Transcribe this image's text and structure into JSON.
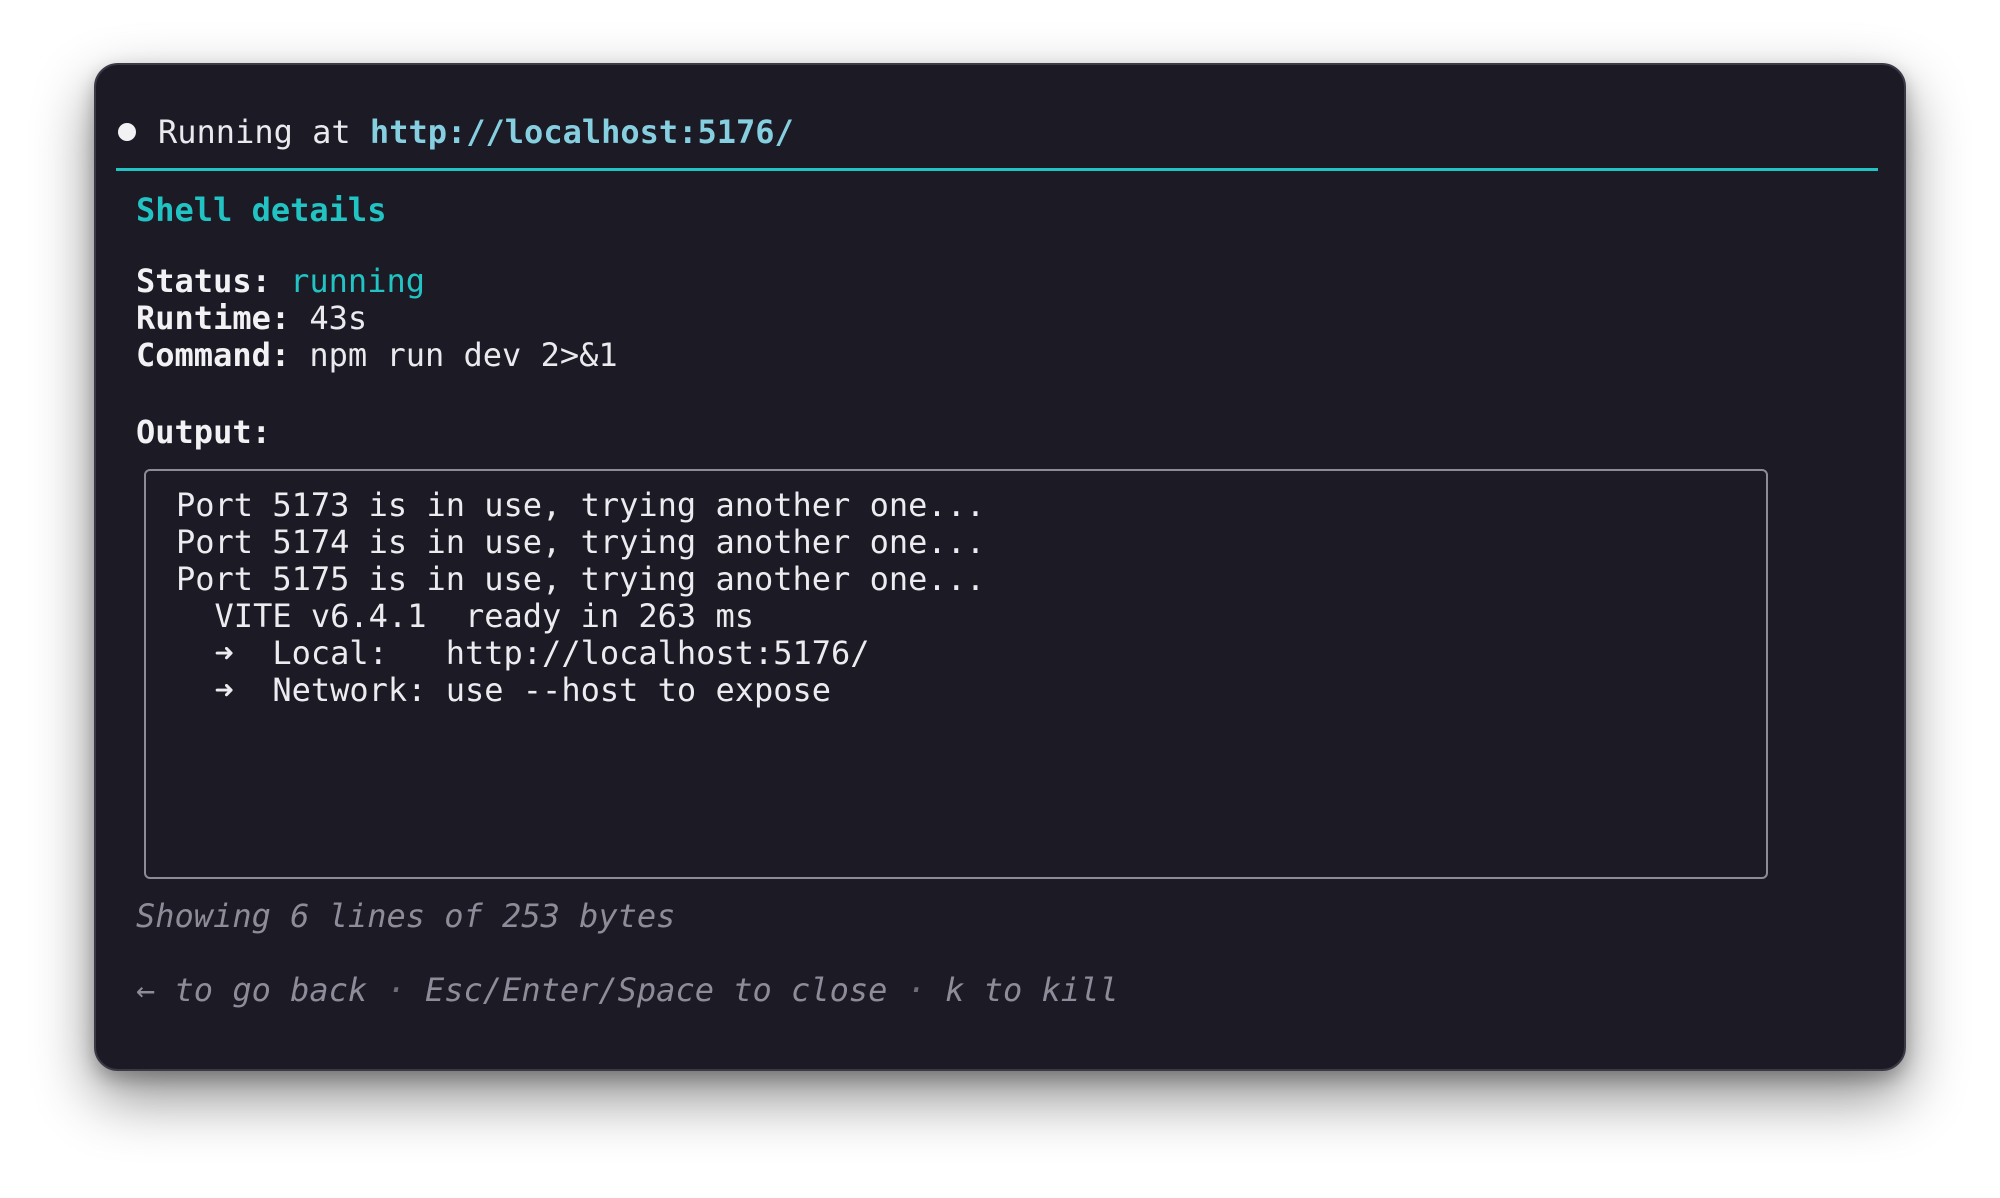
{
  "header": {
    "status_dot": "dot-icon",
    "prefix": "Running at ",
    "url": "http://localhost:5176/"
  },
  "section_title": "Shell details",
  "details": {
    "status_label": "Status:",
    "status_value": "running",
    "runtime_label": "Runtime:",
    "runtime_value": "43s",
    "command_label": "Command:",
    "command_value": "npm run dev 2>&1"
  },
  "output": {
    "label": "Output:",
    "lines": [
      "Port 5173 is in use, trying another one...",
      "Port 5174 is in use, trying another one...",
      "Port 5175 is in use, trying another one...",
      "  VITE v6.4.1  ready in 263 ms",
      "  ➜  Local:   http://localhost:5176/",
      "  ➜  Network: use --host to expose"
    ],
    "summary": "Showing 6 lines of 253 bytes"
  },
  "hints": {
    "back": "← to go back",
    "close": "Esc/Enter/Space to close",
    "kill": "k to kill",
    "separator": " · "
  },
  "colors": {
    "accent": "#22c3c3",
    "url": "#86cfe0",
    "background": "#1b1a25",
    "muted": "#8d8c98"
  }
}
